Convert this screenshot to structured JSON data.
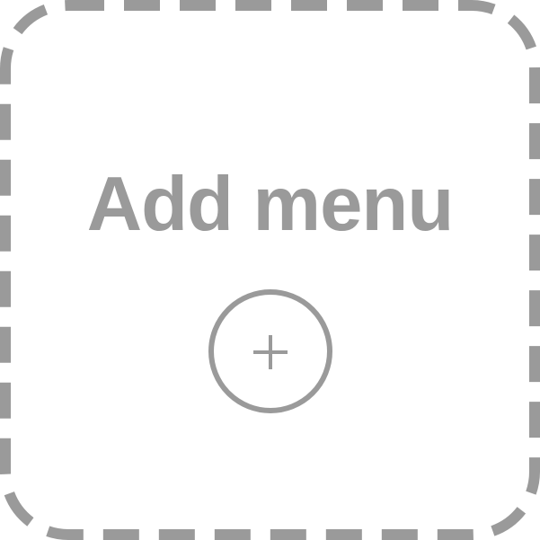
{
  "card": {
    "title": "Add menu",
    "add_icon": "plus-circle-icon"
  },
  "colors": {
    "border": "#9a9a9a",
    "text": "#9a9a9a",
    "background": "#ffffff"
  }
}
